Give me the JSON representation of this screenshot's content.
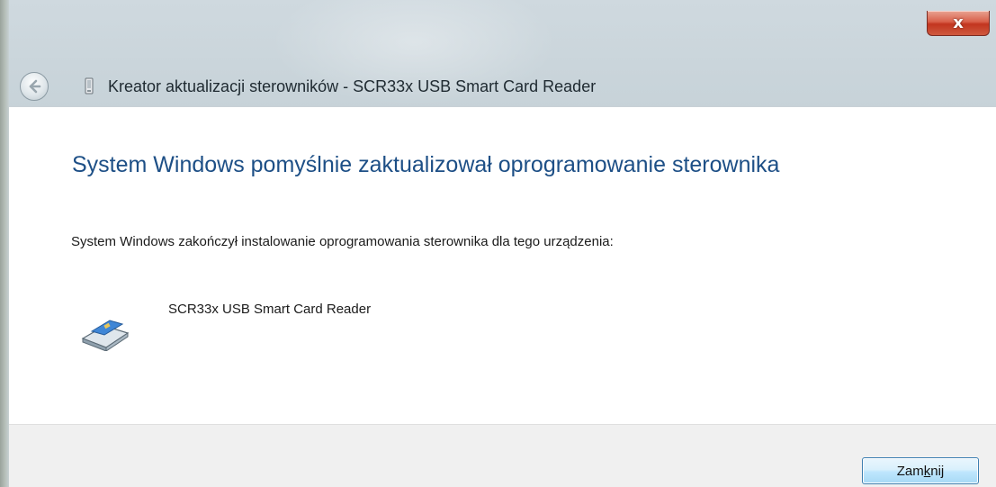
{
  "window": {
    "title": "Kreator aktualizacji sterowników - SCR33x USB Smart Card Reader",
    "close_glyph": "x",
    "back_icon": "back-arrow-icon",
    "app_icon": "wizard-device-icon"
  },
  "content": {
    "heading": "System Windows pomyślnie zaktualizował oprogramowanie sterownika",
    "message": "System Windows zakończył instalowanie oprogramowania sterownika dla tego urządzenia:",
    "device": {
      "name": "SCR33x USB Smart Card Reader",
      "icon": "smart-card-reader-icon"
    }
  },
  "footer": {
    "close_button": {
      "label_before": "Zam",
      "label_mnemonic": "k",
      "label_after": "nij"
    }
  },
  "colors": {
    "heading": "#1d4f86",
    "close_button_red": "#c2351f",
    "button_border": "#3c7fb1"
  }
}
